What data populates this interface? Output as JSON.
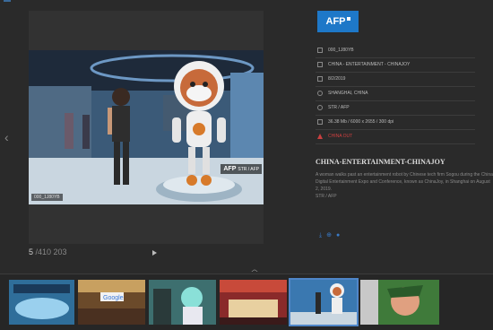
{
  "viewer": {
    "photo_id_tag": "000_1J80YB",
    "photo_credit_logo": "AFP",
    "photo_credit": "STR / AFP",
    "counter_current": "5",
    "counter_total": " /410 203",
    "prev_icon": "chevron-left-icon",
    "next_icon": "play-icon"
  },
  "info": {
    "logo_text": "AFP",
    "meta": [
      {
        "icon": "id-icon",
        "text": "000_1J80YB"
      },
      {
        "icon": "category-icon",
        "text": "CHINA - ENTERTAINMENT - CHINAJOY"
      },
      {
        "icon": "calendar-icon",
        "text": "8/2/2019"
      },
      {
        "icon": "globe-icon",
        "text": "SHANGHAI, CHINA"
      },
      {
        "icon": "camera-icon",
        "text": "STR / AFP"
      },
      {
        "icon": "file-icon",
        "text": "36.38 Mb / 6000 x 2655 / 300 dpi"
      },
      {
        "icon": "warning-icon",
        "text": "CHINA OUT"
      }
    ],
    "headline": "CHINA-ENTERTAINMENT-CHINAJOY",
    "caption": "A woman walks past an entertainment robot by Chinese tech firm Sogou during the China Digital Entertainment Expo and Conference, known as ChinaJoy, in Shanghai on August 2, 2019.",
    "caption_credit": "STR / AFP",
    "actions": [
      "download-icon",
      "zoom-in-icon",
      "share-icon"
    ]
  },
  "filmstrip": {
    "toggle_icon": "chevron-up-icon",
    "thumbs": [
      {
        "name": "thumb-1",
        "color": "#2f6e9a"
      },
      {
        "name": "thumb-2",
        "label": "Google",
        "color": "#6b4a2a"
      },
      {
        "name": "thumb-3",
        "color": "#3d6f6f"
      },
      {
        "name": "thumb-4",
        "color": "#8a2a2a"
      },
      {
        "name": "thumb-5",
        "color": "#3a78b0"
      },
      {
        "name": "thumb-6",
        "color": "#3f7a3a"
      }
    ]
  },
  "colors": {
    "accent": "#1e78c8",
    "warning": "#d04040",
    "selected": "#4f86c8"
  }
}
